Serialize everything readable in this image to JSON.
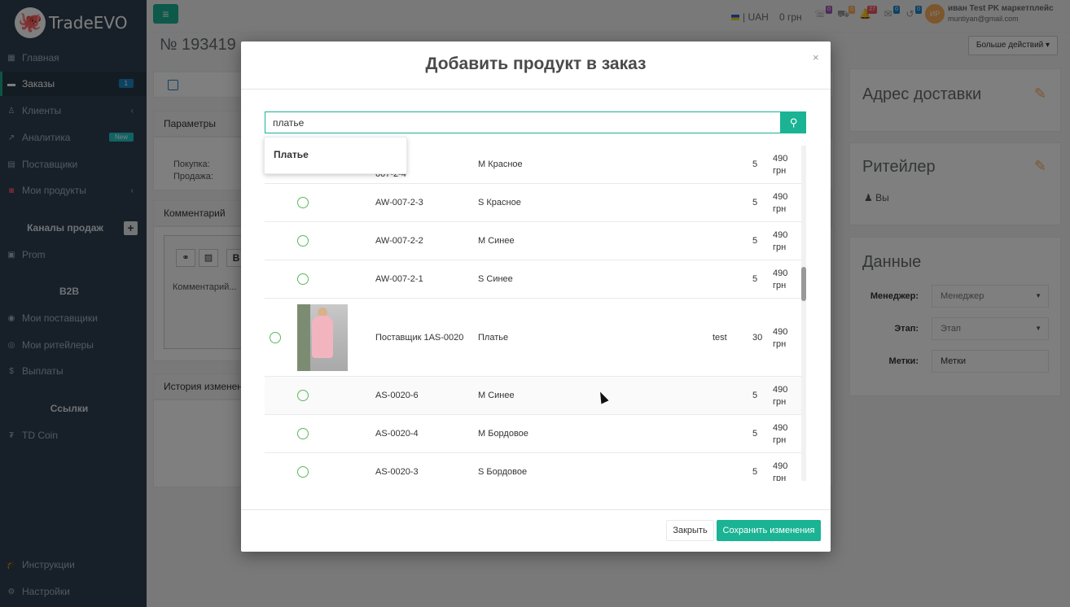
{
  "app": {
    "logo_text": "TradeEVO"
  },
  "sidebar": {
    "items": [
      {
        "label": "Главная",
        "icon": "grid-icon"
      },
      {
        "label": "Заказы",
        "icon": "truck-icon",
        "badge": "1"
      },
      {
        "label": "Клиенты",
        "icon": "user-icon"
      },
      {
        "label": "Аналитика",
        "icon": "chart-icon",
        "badge": "New"
      },
      {
        "label": "Поставщики",
        "icon": "list-icon"
      },
      {
        "label": "Мои продукты",
        "icon": "box-icon"
      }
    ],
    "sales_channels_title": "Каналы продаж",
    "prom_label": "Prom",
    "b2b_title": "B2B",
    "b2b_items": [
      {
        "label": "Мои поставщики"
      },
      {
        "label": "Мои ритейлеры"
      },
      {
        "label": "Выплаты"
      }
    ],
    "links_title": "Ссылки",
    "td_coin_label": "TD Coin",
    "instructions_label": "Инструкции",
    "settings_label": "Настройки"
  },
  "topbar": {
    "currency": "| UAH",
    "balance": "0 грн",
    "notifications": [
      "0",
      "0",
      "27",
      "0",
      "0"
    ],
    "avatar_initials": "ИР",
    "user_name": "иван Test PK маркетплейс",
    "user_email": "muntiyan@gmail.com"
  },
  "page": {
    "order_number": "№ 193419",
    "more_actions": "Больше действий",
    "params_title": "Параметры",
    "purchase_label": "Покупка:",
    "sale_label": "Продажа:",
    "comment_title": "Комментарий",
    "comment_placeholder": "Комментарий...",
    "history_title": "История изменений",
    "delivery_title": "Адрес доставки",
    "retailer_title": "Ритейлер",
    "retailer_value": "Вы",
    "data_title": "Данные",
    "manager_label": "Менеджер:",
    "manager_value": "Менеджер",
    "stage_label": "Этап:",
    "stage_value": "Этап",
    "tags_label": "Метки:",
    "tags_value": "Метки"
  },
  "modal": {
    "title": "Добавить продукт в заказ",
    "search_value": "платье",
    "suggestion": "Платье",
    "close_label": "Закрыть",
    "save_label": "Сохранить изменения",
    "rows": [
      {
        "sku": "AW-007-2-4",
        "variant": "M Красное",
        "extra": "",
        "qty": "5",
        "price": "490",
        "currency": "грн"
      },
      {
        "sku": "AW-007-2-3",
        "variant": "S Красное",
        "extra": "",
        "qty": "5",
        "price": "490",
        "currency": "грн"
      },
      {
        "sku": "AW-007-2-2",
        "variant": "M Синее",
        "extra": "",
        "qty": "5",
        "price": "490",
        "currency": "грн"
      },
      {
        "sku": "AW-007-2-1",
        "variant": "S Синее",
        "extra": "",
        "qty": "5",
        "price": "490",
        "currency": "грн"
      },
      {
        "sku": "Поставщик 1AS-0020",
        "variant": "Платье",
        "extra": "test",
        "qty": "30",
        "price": "490",
        "currency": "грн"
      },
      {
        "sku": "AS-0020-6",
        "variant": "M Синее",
        "extra": "",
        "qty": "5",
        "price": "490",
        "currency": "грн"
      },
      {
        "sku": "AS-0020-4",
        "variant": "M Бордовое",
        "extra": "",
        "qty": "5",
        "price": "490",
        "currency": "грн"
      },
      {
        "sku": "AS-0020-3",
        "variant": "S Бордовое",
        "extra": "",
        "qty": "5",
        "price": "490",
        "currency": "грн"
      }
    ]
  }
}
